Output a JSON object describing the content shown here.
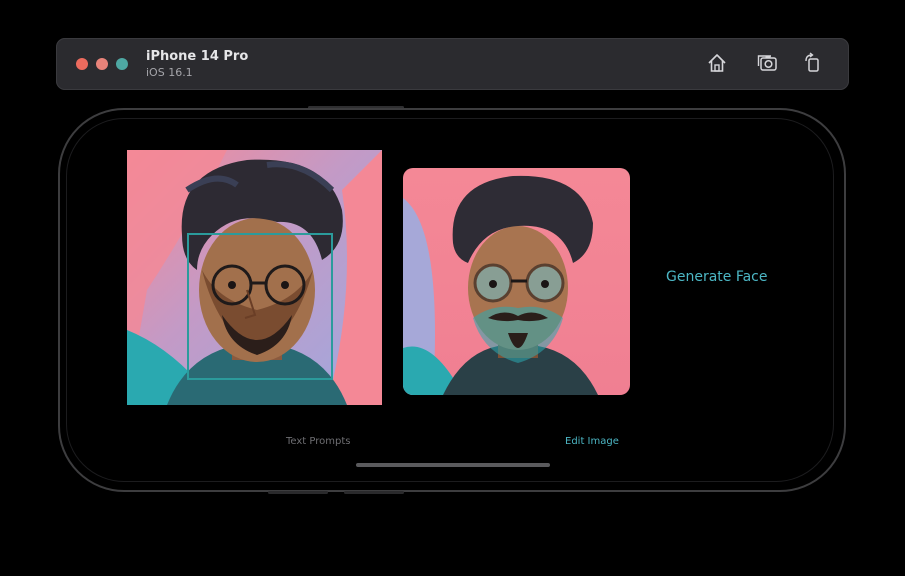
{
  "toolbar": {
    "device_name": "iPhone 14 Pro",
    "os_version": "iOS 16.1",
    "icons": [
      "home-icon",
      "screenshot-icon",
      "rotate-icon"
    ]
  },
  "screen": {
    "generate_label": "Generate Face",
    "tabs": [
      {
        "label": "Text Prompts",
        "selected": false
      },
      {
        "label": "Edit Image",
        "selected": true
      }
    ]
  },
  "colors": {
    "accent": "#4cb6c4",
    "background_pink": "#f48896",
    "teal": "#2b9b9c",
    "lavender": "#a6a8d8"
  }
}
